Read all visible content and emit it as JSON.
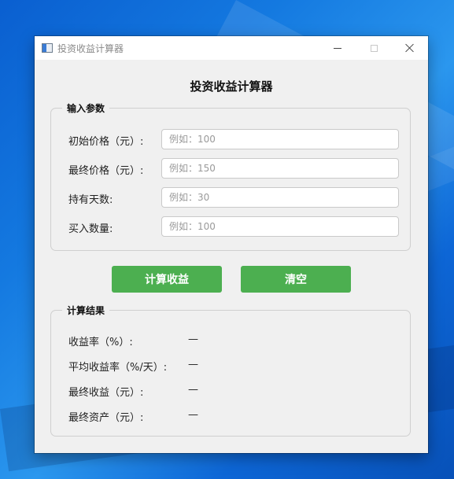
{
  "window": {
    "title": "投资收益计算器",
    "caption": {
      "minimize": "—",
      "maximize": "□",
      "close": "✕"
    }
  },
  "header": {
    "title": "投资收益计算器"
  },
  "input_group": {
    "title": "输入参数",
    "fields": [
      {
        "label": "初始价格（元）:",
        "value": "",
        "placeholder": "例如：100"
      },
      {
        "label": "最终价格（元）:",
        "value": "",
        "placeholder": "例如：150"
      },
      {
        "label": "持有天数:",
        "value": "",
        "placeholder": "例如：30"
      },
      {
        "label": "买入数量:",
        "value": "",
        "placeholder": "例如：100"
      }
    ]
  },
  "buttons": {
    "calculate": "计算收益",
    "clear": "清空",
    "color": "#4caf50"
  },
  "result_group": {
    "title": "计算结果",
    "rows": [
      {
        "label": "收益率（%）:",
        "value": "—"
      },
      {
        "label": "平均收益率（%/天）:",
        "value": "—"
      },
      {
        "label": "最终收益（元）:",
        "value": "—"
      },
      {
        "label": "最终资产（元）:",
        "value": "—"
      }
    ]
  }
}
